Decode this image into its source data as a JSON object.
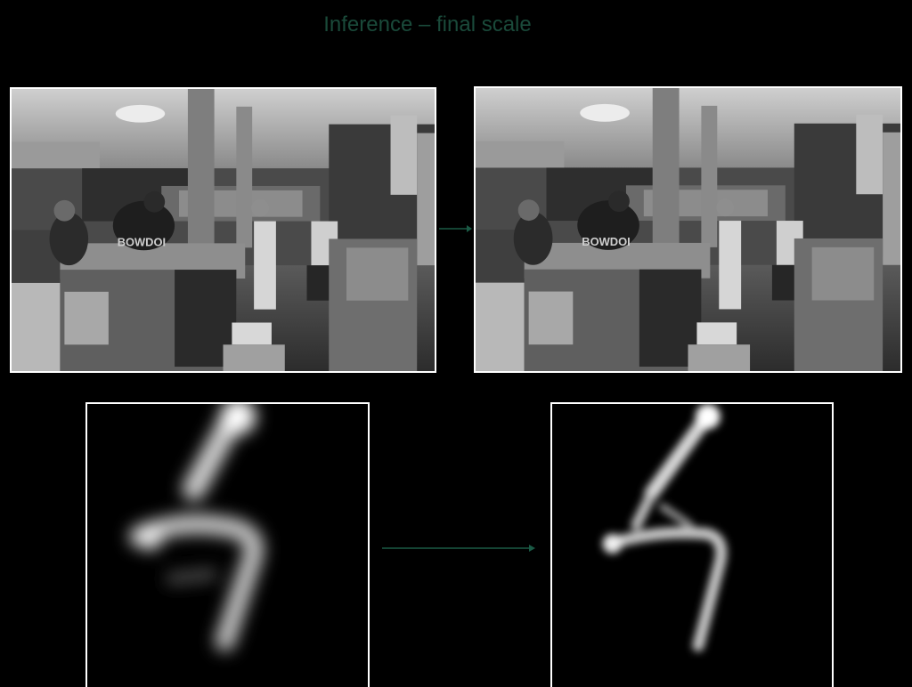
{
  "slide": {
    "title": "Inference – final scale",
    "title_color": "#1a4a3a",
    "background": "#000000",
    "arrow_color": "#1a5a45"
  },
  "photos": {
    "input_shirt_text": "BOWDOI",
    "output_shirt_text": "BOWDOI"
  }
}
